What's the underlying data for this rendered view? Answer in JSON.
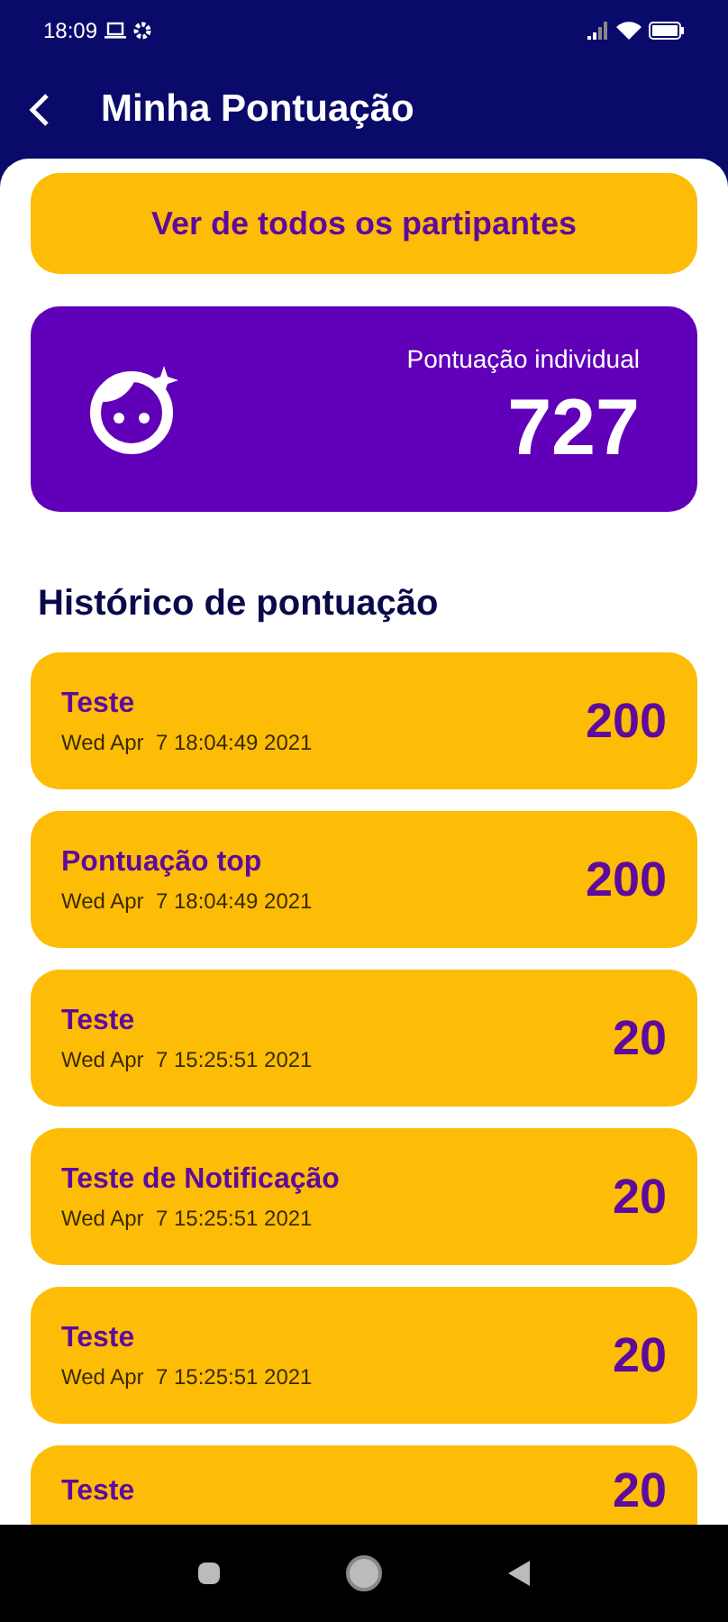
{
  "status_bar": {
    "time": "18:09"
  },
  "header": {
    "title": "Minha Pontuação"
  },
  "all_participants_button": "Ver de todos os partipantes",
  "score_card": {
    "label": "Pontuação individual",
    "value": "727"
  },
  "history": {
    "title": "Histórico de pontuação",
    "items": [
      {
        "title": "Teste",
        "date": "Wed Apr  7 18:04:49 2021",
        "points": "200"
      },
      {
        "title": "Pontuação top",
        "date": "Wed Apr  7 18:04:49 2021",
        "points": "200"
      },
      {
        "title": "Teste",
        "date": "Wed Apr  7 15:25:51 2021",
        "points": "20"
      },
      {
        "title": "Teste de Notificação",
        "date": "Wed Apr  7 15:25:51 2021",
        "points": "20"
      },
      {
        "title": "Teste",
        "date": "Wed Apr  7 15:25:51 2021",
        "points": "20"
      },
      {
        "title": "Teste",
        "points": "20"
      }
    ]
  }
}
